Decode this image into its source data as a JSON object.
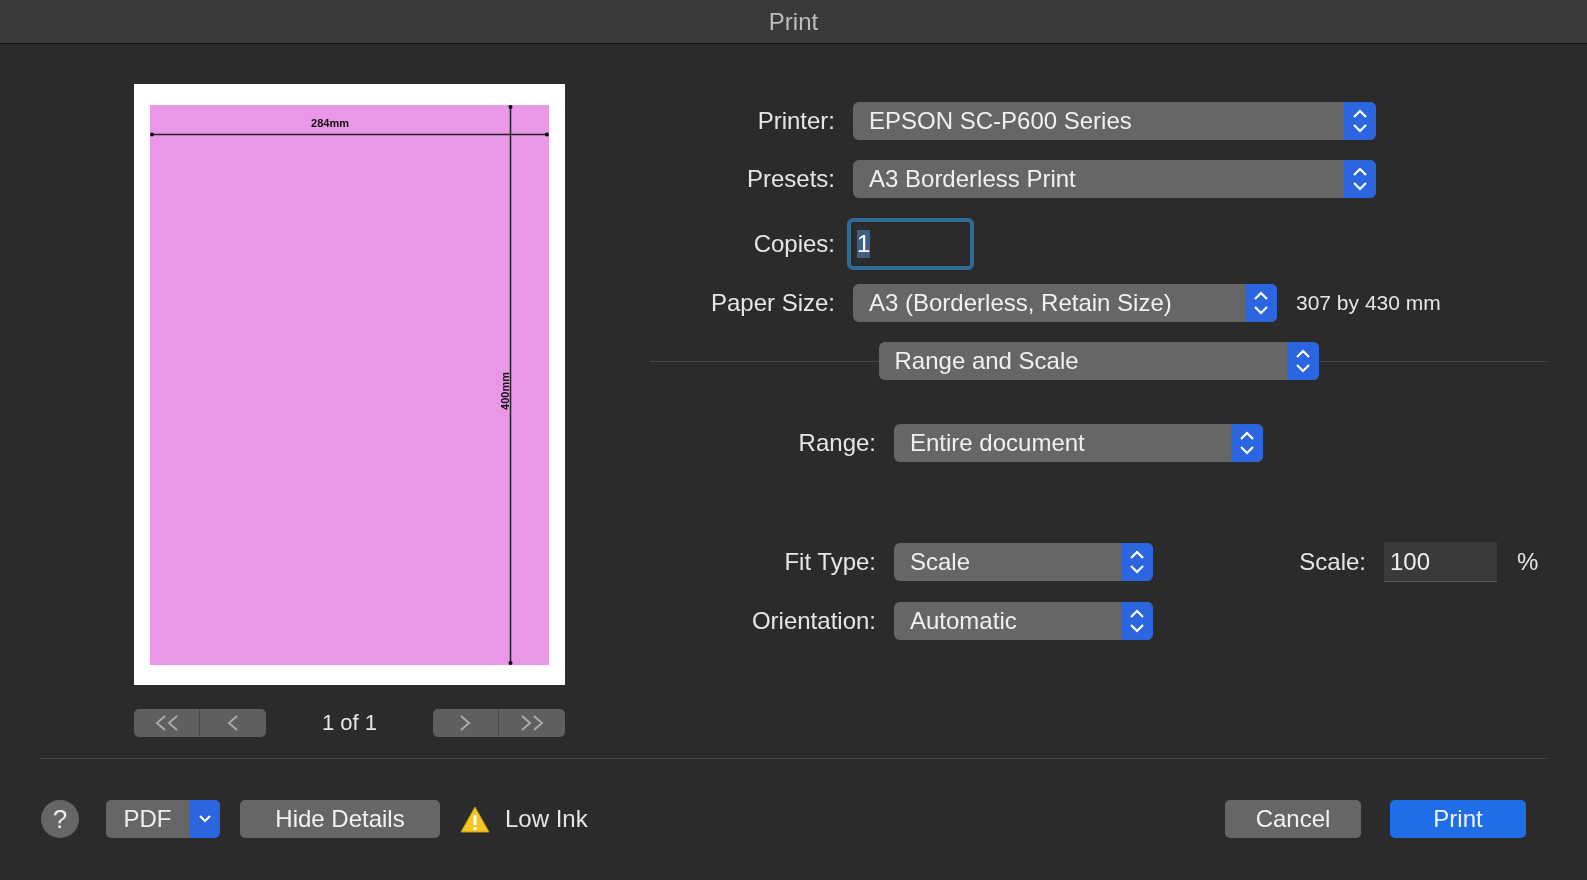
{
  "window": {
    "title": "Print"
  },
  "preview": {
    "width_label": "284mm",
    "height_label": "400mm",
    "page_indicator": "1 of 1"
  },
  "printer": {
    "label": "Printer:",
    "value": "EPSON SC-P600 Series"
  },
  "presets": {
    "label": "Presets:",
    "value": "A3 Borderless Print"
  },
  "copies": {
    "label": "Copies:",
    "value": "1"
  },
  "paper_size": {
    "label": "Paper Size:",
    "value": "A3 (Borderless, Retain Size)",
    "note": "307 by 430 mm"
  },
  "section": {
    "value": "Range and Scale"
  },
  "range": {
    "label": "Range:",
    "value": "Entire document"
  },
  "fit_type": {
    "label": "Fit Type:",
    "value": "Scale"
  },
  "scale": {
    "label": "Scale:",
    "value": "100",
    "unit": "%"
  },
  "orientation": {
    "label": "Orientation:",
    "value": "Automatic"
  },
  "footer": {
    "help": "?",
    "pdf": "PDF",
    "hide_details": "Hide Details",
    "warning": "Low Ink",
    "cancel": "Cancel",
    "print": "Print"
  }
}
